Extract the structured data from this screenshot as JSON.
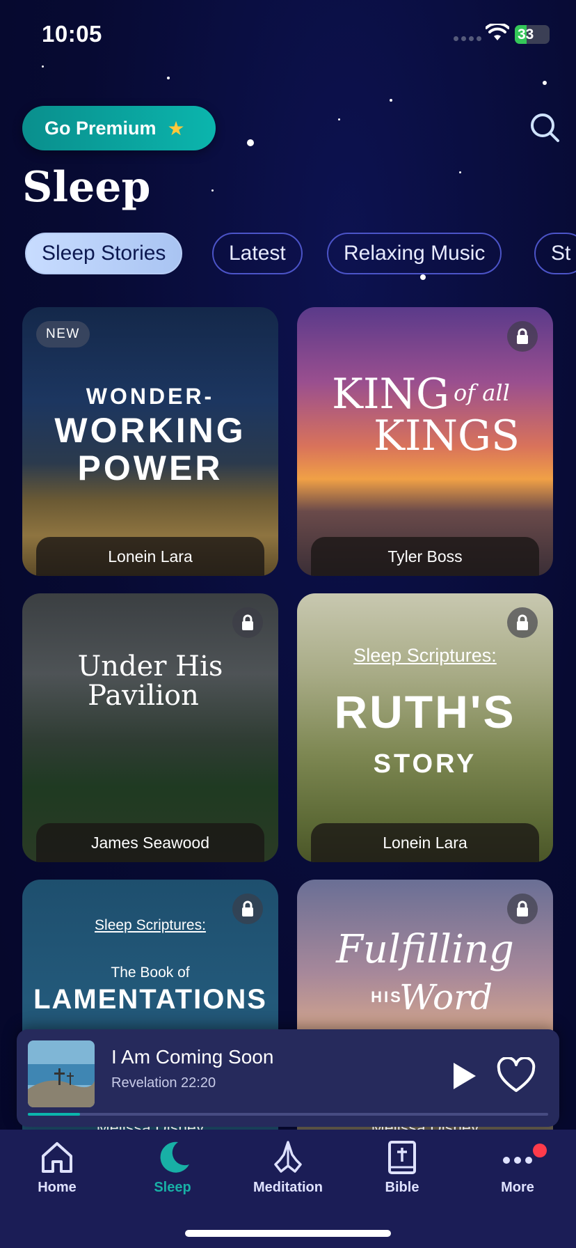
{
  "status_bar": {
    "time": "10:05",
    "battery": "33"
  },
  "header": {
    "premium_label": "Go Premium",
    "title": "Sleep"
  },
  "categories": [
    "Sleep Stories",
    "Latest",
    "Relaxing Music",
    "St"
  ],
  "cards": [
    {
      "badge": "NEW",
      "title_lines": [
        "WONDER-",
        "WORKING",
        "POWER"
      ],
      "author": "Lonein Lara",
      "locked": false
    },
    {
      "title_main": "KING",
      "title_of": "of all",
      "title_second": "KINGS",
      "author": "Tyler Boss",
      "locked": true
    },
    {
      "title_lines": [
        "Under His",
        "Pavilion"
      ],
      "author": "James Seawood",
      "locked": true
    },
    {
      "kicker": "Sleep Scriptures:",
      "title_lines": [
        "RUTH'S",
        "STORY"
      ],
      "author": "Lonein Lara",
      "locked": true
    },
    {
      "kicker": "Sleep Scriptures:",
      "title_lines": [
        "The Book of",
        "LAMENTATIONS"
      ],
      "author": "Melissa Disney",
      "locked": true
    },
    {
      "title_lines": [
        "Fulfilling",
        "HIS",
        "Word"
      ],
      "author": "Melissa Disney",
      "locked": true
    }
  ],
  "player": {
    "title": "I Am Coming Soon",
    "subtitle": "Revelation 22:20",
    "progress": 0.1
  },
  "tabs": [
    {
      "label": "Home",
      "icon": "home-icon"
    },
    {
      "label": "Sleep",
      "icon": "moon-icon",
      "active": true
    },
    {
      "label": "Meditation",
      "icon": "praying-hands-icon"
    },
    {
      "label": "Bible",
      "icon": "bible-icon"
    },
    {
      "label": "More",
      "icon": "more-icon",
      "notification": true
    }
  ],
  "colors": {
    "accent": "#18b0a6",
    "background": "#070a32",
    "chip_active": "#c8dcff"
  }
}
